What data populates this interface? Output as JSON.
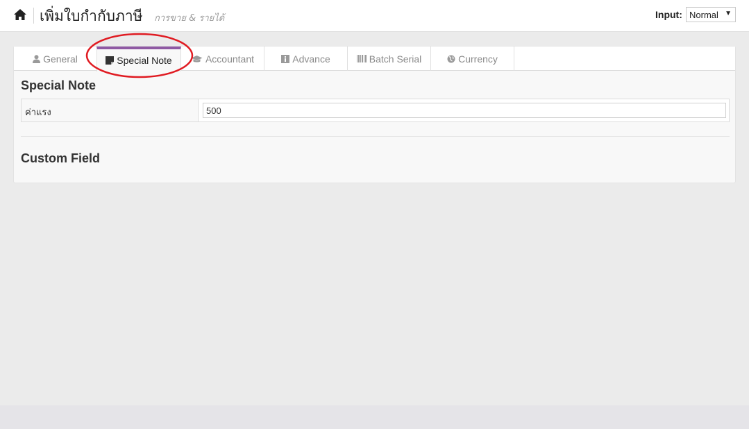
{
  "header": {
    "title": "เพิ่มใบกำกับภาษี",
    "subtitle": "การขาย & รายได้",
    "input_label": "Input:",
    "input_mode": "Normal"
  },
  "tabs": [
    {
      "label": "General",
      "icon": "user-icon",
      "active": false
    },
    {
      "label": "Special Note",
      "icon": "note-icon",
      "active": true
    },
    {
      "label": "Accountant",
      "icon": "graduation-cap-icon",
      "active": false
    },
    {
      "label": "Advance",
      "icon": "info-icon",
      "active": false
    },
    {
      "label": "Batch Serial",
      "icon": "barcode-icon",
      "active": false
    },
    {
      "label": "Currency",
      "icon": "globe-icon",
      "active": false
    }
  ],
  "special_note": {
    "heading": "Special Note",
    "fields": [
      {
        "label": "ค่าแรง",
        "value": "500"
      }
    ]
  },
  "custom_field": {
    "heading": "Custom Field"
  },
  "colors": {
    "accent": "#8e59a3",
    "annotation": "#e01b22",
    "background": "#ebebeb"
  }
}
